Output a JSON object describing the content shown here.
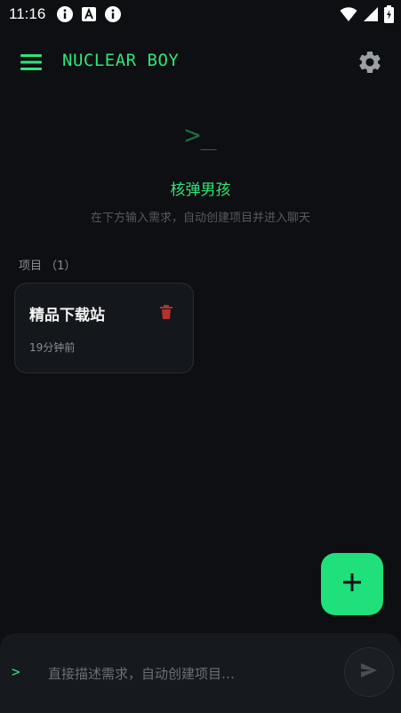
{
  "status_bar": {
    "time": "11:16",
    "left_icons": [
      "info-icon",
      "font-icon",
      "info-icon"
    ],
    "right_icons": [
      "wifi-icon",
      "signal-icon",
      "battery-icon"
    ]
  },
  "app_bar": {
    "title": "NUCLEAR BOY",
    "menu_icon": "menu-icon",
    "settings_icon": "gear-icon"
  },
  "hero": {
    "prompt": ">_",
    "title": "核弹男孩",
    "subtitle": "在下方输入需求，自动创建项目并进入聊天"
  },
  "projects": {
    "label": "项目 （1）",
    "items": [
      {
        "name": "精品下载站",
        "time": "19分钟前"
      }
    ]
  },
  "fab": {
    "icon": "plus-icon"
  },
  "input": {
    "prompt": ">",
    "placeholder": "直接描述需求，自动创建项目…",
    "value": "",
    "send_icon": "send-icon"
  },
  "colors": {
    "background": "#0d0f12",
    "accent": "#2ee57a",
    "fab": "#1fe07a",
    "card": "#14171b",
    "delete": "#b3322c"
  }
}
